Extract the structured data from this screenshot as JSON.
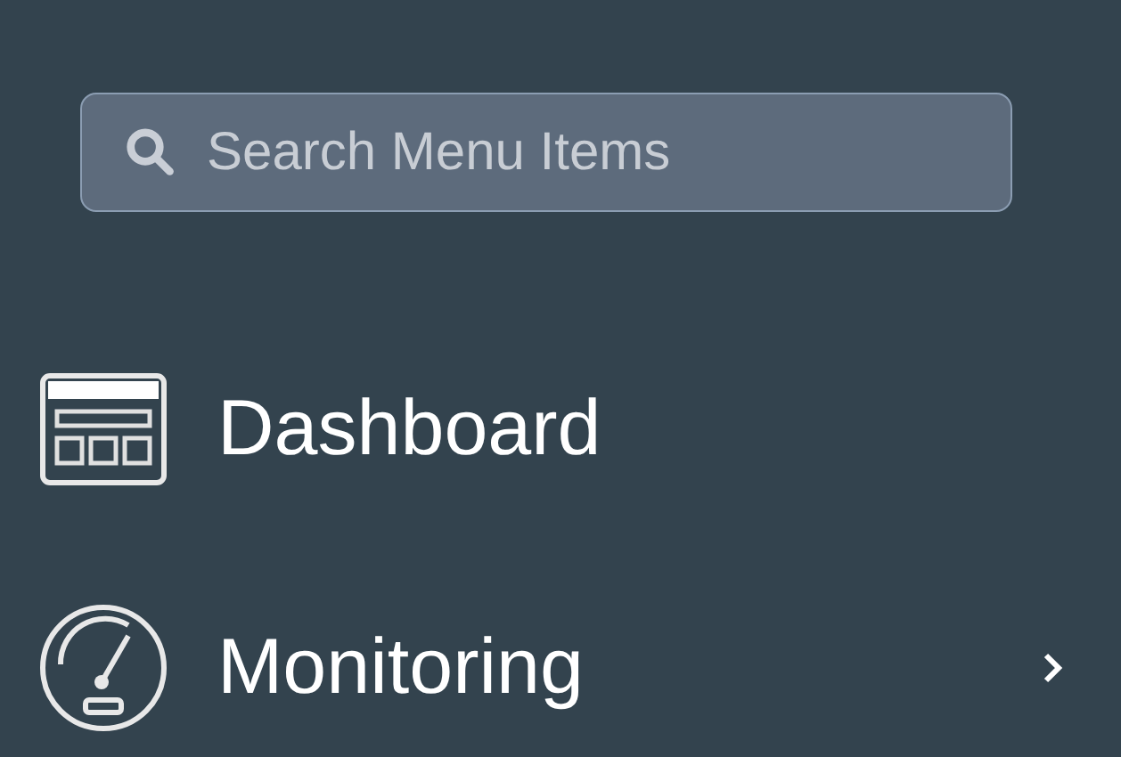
{
  "search": {
    "placeholder": "Search Menu Items"
  },
  "menu": [
    {
      "label": "Dashboard",
      "kind": "dashboard",
      "has_submenu": false
    },
    {
      "label": "Monitoring",
      "kind": "gauge",
      "has_submenu": true
    }
  ]
}
